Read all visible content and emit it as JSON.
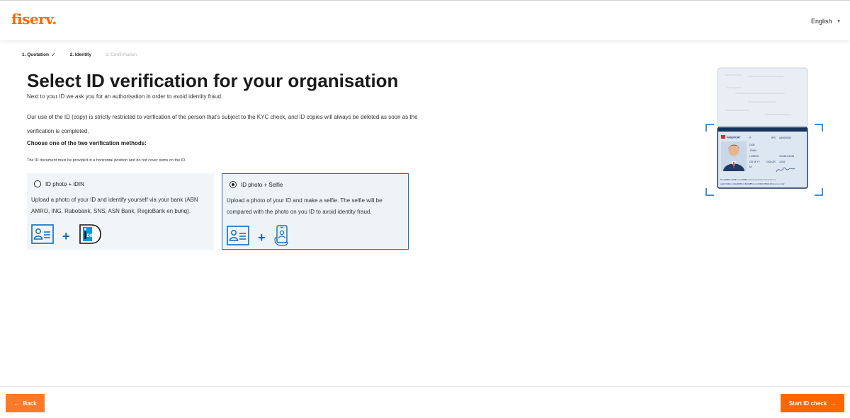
{
  "header": {
    "logo": "fiserv.",
    "language": "English",
    "language_caret": "▾"
  },
  "steps": [
    {
      "label": "1. Quotation",
      "state": "done",
      "mark": "✓"
    },
    {
      "label": "2. Identity",
      "state": "active"
    },
    {
      "label": "3. Confirmation",
      "state": "todo"
    }
  ],
  "main": {
    "title": "Select ID verification for your organisation",
    "intro": "Next to your ID we ask you for an authorisation in order to avoid identity fraud.",
    "privacy": "Our use of the ID (copy) is strictly restricted to verification of the person that's subject to the KYC check, and ID copies will always be deleted as soon as the verification is completed.",
    "choose_label": "Choose one of the two verification methods:",
    "note": "The ID document must be provided in a horizontal position and do not cover items on the ID."
  },
  "options": [
    {
      "title": "ID photo + iDIN",
      "description": "Upload a photo of your ID and identify yourself via your bank (ABN AMRO, ING, Rabobank, SNS, ASN Bank, RegioBank en bunq).",
      "selected": false,
      "plus": "+",
      "idin_text": "iDIN"
    },
    {
      "title": "ID photo + Selfie",
      "description": "Upload a photo of your ID and make a selfie. The selfie will be compared with the photo on you ID to avoid identity fraud.",
      "selected": true,
      "plus": "+"
    }
  ],
  "passport": {
    "label": "PASSPORT",
    "type": "P",
    "country": "IPS",
    "number": "AA000000",
    "surname": "DOE",
    "given_name": "JOHN",
    "nationality": "LOREM",
    "dob": "DD M YY",
    "personal_no": "12345-01234",
    "field_dolor": "DOLOR",
    "field_1234": "1234",
    "sex": "M",
    "mrz1": "P<LOREM<<<DOE<<<<JOHN<<<<<<<<<<<<<<<<<<<<<<<<",
    "mrz2": "AA123456<<<8LOREM<<<8LOREM<<<12345678901234<<<<<<<12"
  },
  "footer": {
    "back_label": "Back",
    "back_icon": "←",
    "start_label": "Start ID check",
    "start_icon": "→"
  },
  "colors": {
    "brand_orange": "#ff6600",
    "selected_border": "#1565c0",
    "icon_blue": "#0d6bbf"
  }
}
